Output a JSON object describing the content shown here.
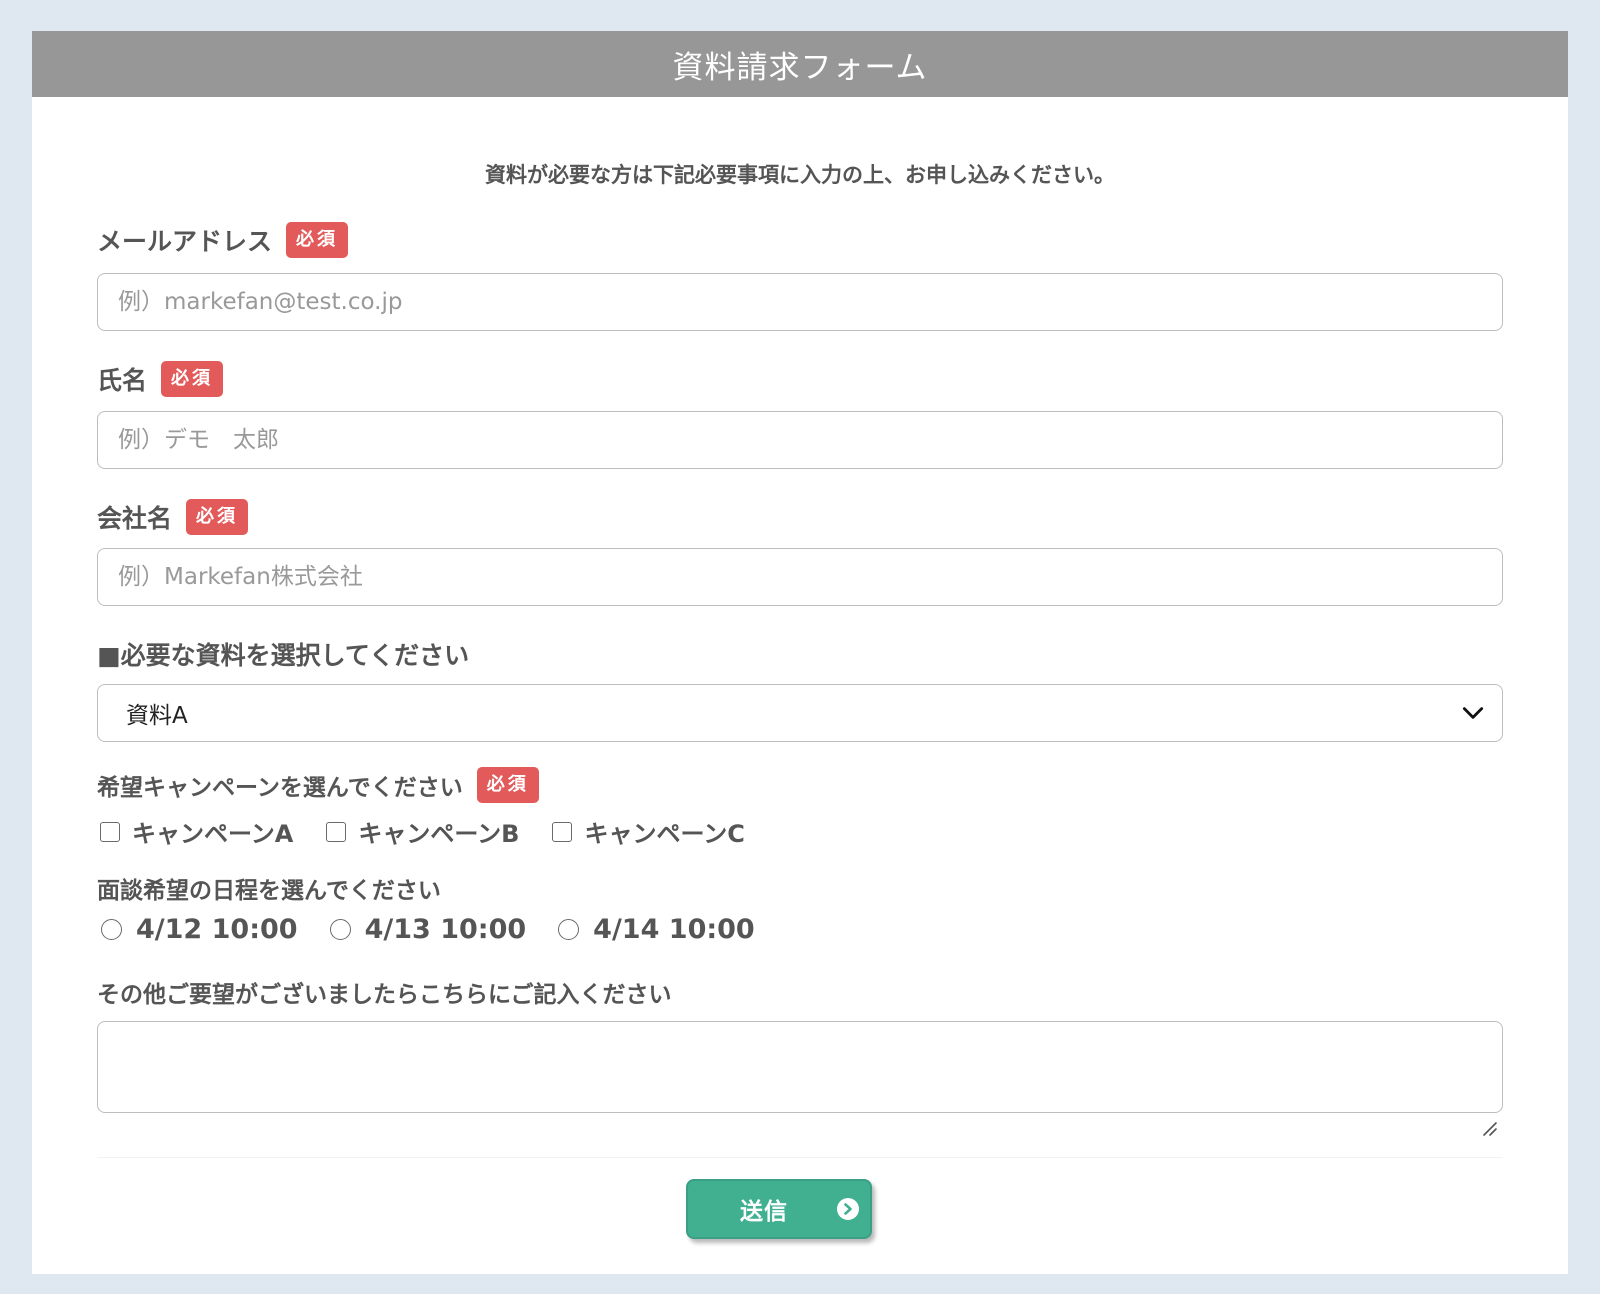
{
  "form": {
    "title": "資料請求フォーム",
    "intro": "資料が必要な方は下記必要事項に入力の上、お申し込みください。",
    "required_badge": "必須",
    "email": {
      "label": "メールアドレス",
      "placeholder": "例）markefan@test.co.jp"
    },
    "name": {
      "label": "氏名",
      "placeholder": "例）デモ　太郎"
    },
    "company": {
      "label": "会社名",
      "placeholder": "例）Markefan株式会社"
    },
    "material": {
      "label": "■必要な資料を選択してください",
      "selected": "資料A"
    },
    "campaign": {
      "label": "希望キャンペーンを選んでください",
      "options": [
        "キャンペーンA",
        "キャンペーンB",
        "キャンペーンC"
      ]
    },
    "schedule": {
      "label": "面談希望の日程を選んでください",
      "options": [
        "4/12 10:00",
        "4/13 10:00",
        "4/14 10:00"
      ]
    },
    "notes": {
      "label": "その他ご要望がございましたらこちらにご記入ください",
      "value": ""
    },
    "submit_label": "送信"
  },
  "colors": {
    "header_bg": "#979797",
    "required_badge": "#e25a5a",
    "submit_bg": "#40b091",
    "page_bg": "#dfe7f1"
  },
  "icons": {
    "select": "chevron-down-icon",
    "submit": "arrow-right-circle-icon"
  }
}
